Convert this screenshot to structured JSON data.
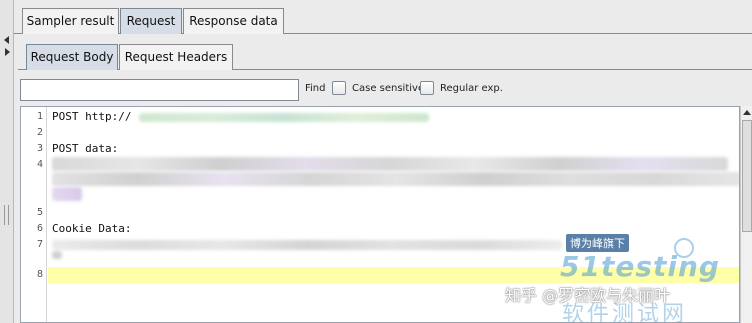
{
  "outer_tabs": [
    {
      "label": "Sampler result",
      "selected": false
    },
    {
      "label": "Request",
      "selected": true
    },
    {
      "label": "Response data",
      "selected": false
    }
  ],
  "inner_tabs": [
    {
      "label": "Request Body",
      "selected": true
    },
    {
      "label": "Request Headers",
      "selected": false
    }
  ],
  "search": {
    "value": "",
    "find_label": "Find",
    "case_sensitive_label": "Case sensitive",
    "case_sensitive_checked": false,
    "regular_exp_label": "Regular exp.",
    "regular_exp_checked": false
  },
  "editor": {
    "lines": [
      {
        "num": "1",
        "text": "POST http://"
      },
      {
        "num": "2",
        "text": ""
      },
      {
        "num": "3",
        "text": "POST data:"
      },
      {
        "num": "4",
        "text": ""
      },
      {
        "num": "5",
        "text": ""
      },
      {
        "num": "6",
        "text": "Cookie Data:"
      },
      {
        "num": "7",
        "text": ""
      },
      {
        "num": "8",
        "text": ""
      }
    ],
    "highlight_line": "8"
  },
  "watermark": {
    "badge": "博为峰旗下",
    "brand": "51testing",
    "subtitle": "软件测试网",
    "zhihu": "知乎 @罗密欧与朱丽叶"
  },
  "colors": {
    "selected_tab": "#d6dde6",
    "highlight_line": "#ffffa8"
  }
}
